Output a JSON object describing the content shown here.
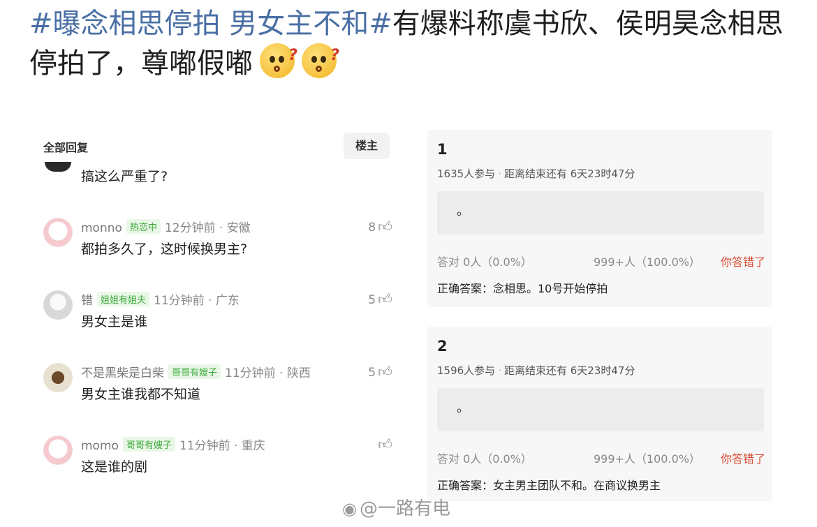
{
  "post": {
    "topic": "#曝念相思停拍 男女主不和#",
    "text": "有爆料称虞书欣、侯明昊念相思停拍了，尊嘟假嘟",
    "emoji": "thinking-face-emoji"
  },
  "comments": {
    "header": "全部回复",
    "owner_button": "楼主",
    "first_text": "搞这么严重了?",
    "items": [
      {
        "user": "monno",
        "badge": "热恋中",
        "time": "12分钟前 · 安徽",
        "text": "都拍多久了，这时候换男主?",
        "likes": "8"
      },
      {
        "user": "错",
        "badge": "姐姐有姐夫",
        "time": "11分钟前 · 广东",
        "text": "男女主是谁",
        "likes": "5"
      },
      {
        "user": "不是黑柴是白柴",
        "badge": "哥哥有嫂子",
        "time": "11分钟前 · 陕西",
        "text": "男女主谁我都不知道",
        "likes": "5"
      },
      {
        "user": "momo",
        "badge": "哥哥有嫂子",
        "time": "11分钟前 · 重庆",
        "text": "这是谁的剧",
        "likes": ""
      }
    ]
  },
  "quiz": [
    {
      "number": "1",
      "participants": "1635人参与",
      "remaining": "距离结束还有 6天23时47分",
      "answer": "。",
      "right": "答对 0人（0.0%）",
      "wrong_count": "999+人（100.0%）",
      "result": "你答错了",
      "correct": "正确答案：念相思。10号开始停拍"
    },
    {
      "number": "2",
      "participants": "1596人参与",
      "remaining": "距离结束还有 6天23时47分",
      "answer": "。",
      "right": "答对 0人（0.0%）",
      "wrong_count": "999+人（100.0%）",
      "result": "你答错了",
      "correct": "正确答案：女主男主团队不和。在商议换男主"
    }
  ],
  "watermark": "@一路有电",
  "colors": {
    "topic": "#4a6fa5",
    "badge_green": "#3caa3c",
    "wrong_red": "#d8452c"
  }
}
